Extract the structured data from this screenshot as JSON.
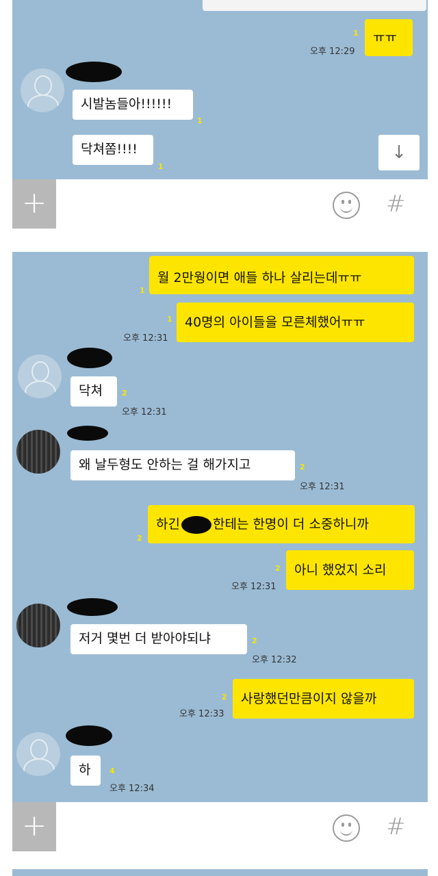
{
  "shot1": {
    "my_last": {
      "text": "ㅠㅠ",
      "time": "오후 12:29",
      "unread": "1"
    },
    "sender_messages": [
      {
        "text": "시발놈들아!!!!!!",
        "unread": "1"
      },
      {
        "text": "닥쳐쫌!!!!",
        "unread": "1"
      }
    ],
    "scroll_icon": "arrow-down-icon"
  },
  "input_bar": {
    "plus": "+",
    "hash": "#",
    "emoji_icon": "smile-icon"
  },
  "shot2": {
    "m1": {
      "text": "월 2만웡이면 애들 하나 살리는데ㅠㅠ",
      "unread": "1"
    },
    "m2": {
      "text": "40명의 아이들을 모른체했어ㅠㅠ",
      "unread": "1",
      "time": "오후 12:31"
    },
    "m3": {
      "text": "닥쳐",
      "unread": "2",
      "time": "오후 12:31"
    },
    "m4": {
      "text": "왜 날두형도 안하는 걸 해가지고",
      "unread": "2",
      "time": "오후 12:31"
    },
    "m5": {
      "text_a": "하긴",
      "text_b": "한테는 한명이 더 소중하니까",
      "unread": "2"
    },
    "m6": {
      "text": "아니 했었지 소리",
      "unread": "2",
      "time": "오후 12:31"
    },
    "m7": {
      "text": "저거 몇번 더 받아야되냐",
      "unread": "2",
      "time": "오후 12:32"
    },
    "m8": {
      "text": "사랑했던만큼이지 않을까",
      "unread": "2",
      "time": "오후 12:33"
    },
    "m9": {
      "text": "하",
      "unread": "4",
      "time": "오후 12:34"
    }
  },
  "colors": {
    "chat_bg": "#9bbbd4",
    "my_bubble": "#fee500",
    "other_bubble": "#ffffff",
    "unread": "#f7e600"
  }
}
